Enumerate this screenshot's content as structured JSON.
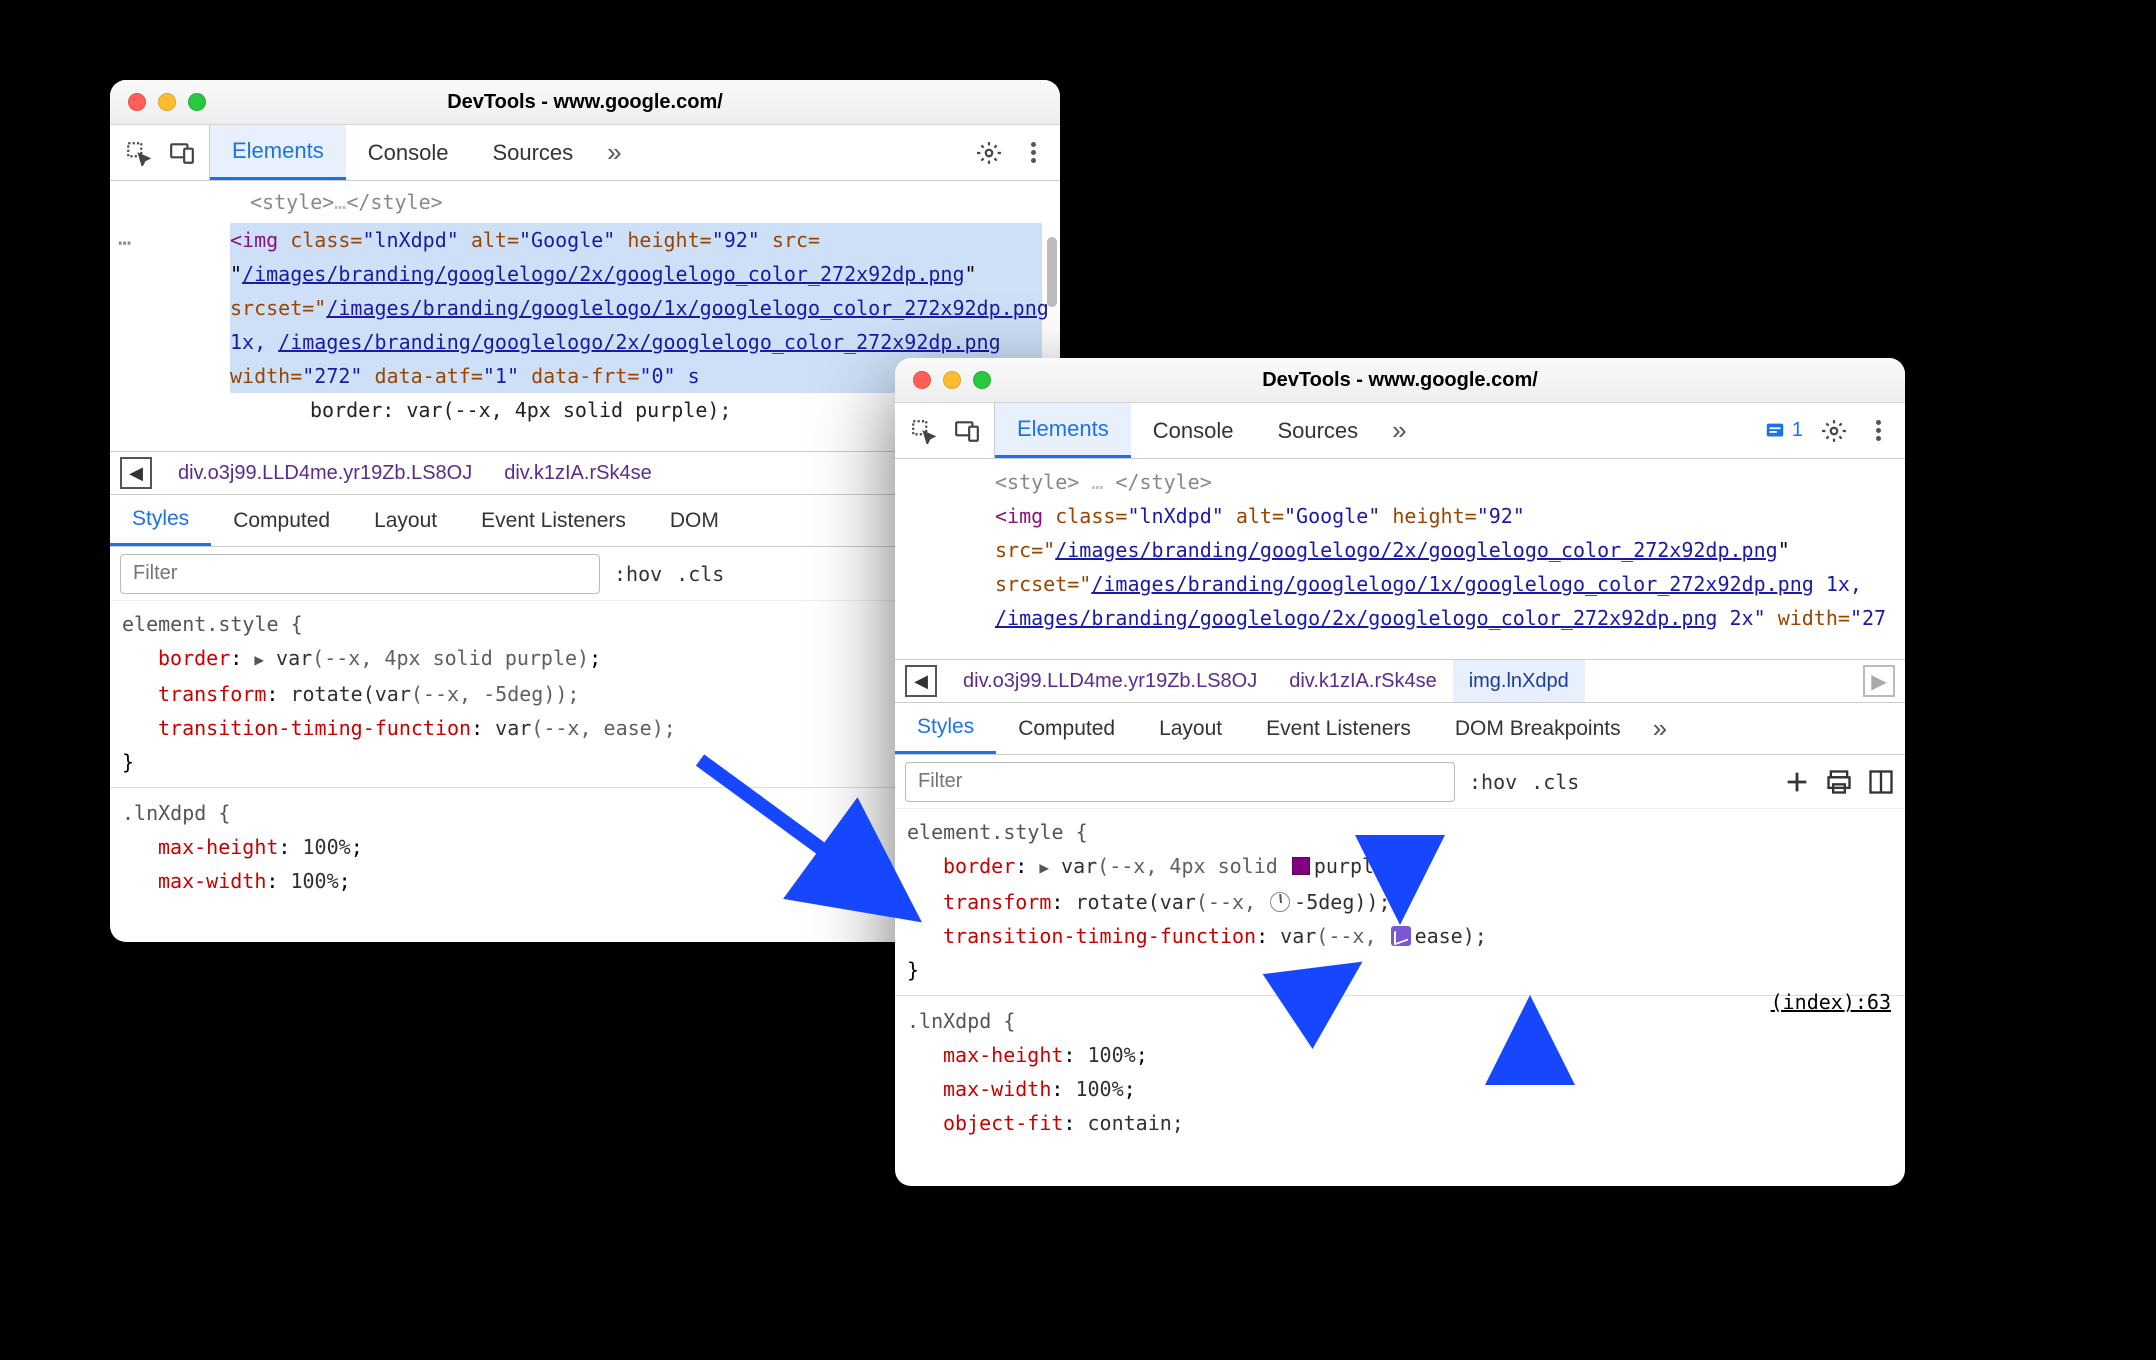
{
  "window_title": "DevTools - www.google.com/",
  "main_tabs": {
    "elements": "Elements",
    "console": "Console",
    "sources": "Sources"
  },
  "issue_count": "1",
  "domA": {
    "pre_line": "<style>…</style>",
    "img_open": "<img",
    "a_class": "class=",
    "v_class": "\"lnXdpd\"",
    "a_alt": "alt=",
    "v_alt": "\"Google\"",
    "a_height": "height=",
    "v_height": "\"92\"",
    "a_src": "src=",
    "src_link": "/images/branding/googlelogo/2x/googlelogo_color_272x92dp.png",
    "a_srcset": "srcset=\"",
    "ss1": "/images/branding/googlelogo/1x/googlelogo_color_272x92dp.png",
    "ss1_tail": " 1x, ",
    "ss2": "/images/branding/googlelogo/2x/googlelogo_color_272x92dp.png",
    "a_width": "width=",
    "v_width": "\"272\"",
    "a_atf": "data-atf=",
    "v_atf": "\"1\"",
    "a_frt": "data-frt=",
    "v_frt": "\"0\"",
    "s_tail": " s",
    "inline_style": "border: var(--x, 4px solid purple);"
  },
  "crumbsA": {
    "c1": "div.o3j99.LLD4me.yr19Zb.LS8OJ",
    "c2": "div.k1zIA.rSk4se"
  },
  "sub_tabs": {
    "styles": "Styles",
    "computed": "Computed",
    "layout": "Layout",
    "el": "Event Listeners",
    "domb": "DOM Breakpoints"
  },
  "filter": {
    "placeholder": "Filter",
    "hov": ":hov",
    "cls": ".cls"
  },
  "stylesA": {
    "rule1_sel": "element.style {",
    "p1": "border",
    "v1": "var",
    "v1b": "(--x, 4px solid purple)",
    "p2": "transform",
    "v2a": "rotate(",
    "v2b": "var",
    "v2c": "(--x, -5deg));",
    "p3": "transition-timing-function",
    "v3a": "var",
    "v3b": "(--x, ease);",
    "close": "}",
    "rule2_sel": ".lnXdpd {",
    "p4": "max-height",
    "v4": "100%",
    "p5": "max-width",
    "v5": "100%"
  },
  "domB": {
    "pre": "<style> … </style>",
    "img_open": "<img",
    "a_class": "class=",
    "v_class": "\"lnXdpd\"",
    "a_alt": "alt=",
    "v_alt": "\"Google\"",
    "a_height": "height=",
    "v_height": "\"92\"",
    "a_src": "src=\"",
    "src_link": "/images/branding/googlelogo/2x/googlelogo_color_272x92dp.png",
    "a_srcset": "srcset=\"",
    "ss1": "/images/branding/googlelogo/1x/googlelogo_color_272x92dp.png",
    "ss1_tail": " 1x, ",
    "ss2": "/images/branding/googlelogo/2x/googlelogo_color_272x92dp.png",
    "ss2_tail": " 2x\"",
    "a_width": "width=",
    "v_width": "\"27"
  },
  "crumbsB": {
    "c1": "div.o3j99.LLD4me.yr19Zb.LS8OJ",
    "c2": "div.k1zIA.rSk4se",
    "c3": "img.lnXdpd"
  },
  "stylesB": {
    "rule1_sel": "element.style {",
    "p1": "border",
    "v1a": "var",
    "v1b": "(--x, 4px solid",
    "v1c": "purple);",
    "p2": "transform",
    "v2a": "rotate(",
    "v2b": "var",
    "v2c": "(--x,",
    "v2d": "-5deg));",
    "p3": "transition-timing-function",
    "v3a": "var",
    "v3b": "(--x,",
    "v3c": "ease);",
    "close": "}",
    "rule2_sel": ".lnXdpd {",
    "p4": "max-height",
    "v4": "100%",
    "p5": "max-width",
    "v5": "100%",
    "p6": "object-fit",
    "v6": "contain;",
    "idx": "(index):63"
  },
  "colors": {
    "purple_swatch": "#800080",
    "bezier": "#7b57d6"
  }
}
